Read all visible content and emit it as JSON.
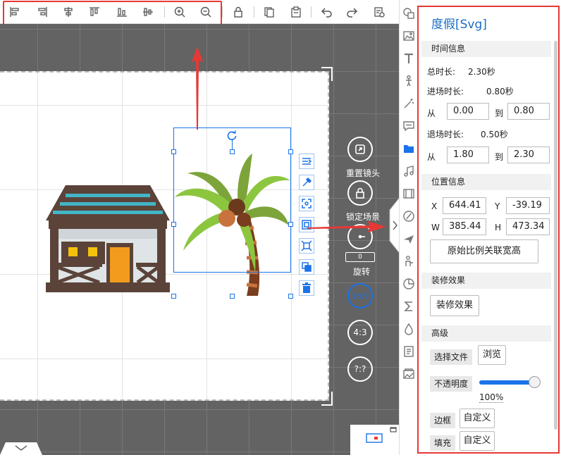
{
  "toolbar": {
    "icons": [
      "align-left-icon",
      "align-right-icon",
      "align-center-h-icon",
      "align-top-icon",
      "align-bottom-icon",
      "align-center-v-icon",
      "zoom-in-icon",
      "zoom-out-icon",
      "lock-icon",
      "copy-icon",
      "paste-icon",
      "undo-icon",
      "redo-icon",
      "settings-icon"
    ]
  },
  "canvas": {
    "controls": {
      "reset_camera": "重置镜头",
      "lock_scene": "锁定场景",
      "rotation_value": "0",
      "rotate": "旋转",
      "ratio_16_9": "16:9",
      "ratio_4_3": "4:3",
      "ratio_custom": "?:?"
    }
  },
  "panel": {
    "title": "度假[Svg]",
    "time_section": "时间信息",
    "total_label": "总时长:",
    "total_value": "2.30秒",
    "enter_label": "进场时长:",
    "enter_value": "0.80秒",
    "from_label": "从",
    "to_label": "到",
    "enter_from": "0.00",
    "enter_to": "0.80",
    "exit_label": "退场时长:",
    "exit_value": "0.50秒",
    "exit_from": "1.80",
    "exit_to": "2.30",
    "position_section": "位置信息",
    "x_label": "X",
    "x_value": "644.41",
    "y_label": "Y",
    "y_value": "-39.19",
    "w_label": "W",
    "w_value": "385.44",
    "h_label": "H",
    "h_value": "473.34",
    "link_ratio_button": "原始比例关联宽高",
    "decor_section": "装修效果",
    "decor_button": "装修效果",
    "advanced_section": "高级",
    "choose_file_label": "选择文件",
    "browse_button": "浏览",
    "opacity_label": "不透明度",
    "opacity_value": "100%",
    "opacity_fraction": 1.0,
    "border_label": "边框",
    "border_button": "自定义",
    "fill_label": "填充",
    "fill_button": "自定义"
  },
  "colors": {
    "accent": "#1a73e8",
    "highlight": "#e53935",
    "title": "#1a6ec5",
    "canvas_bg": "#636363"
  }
}
